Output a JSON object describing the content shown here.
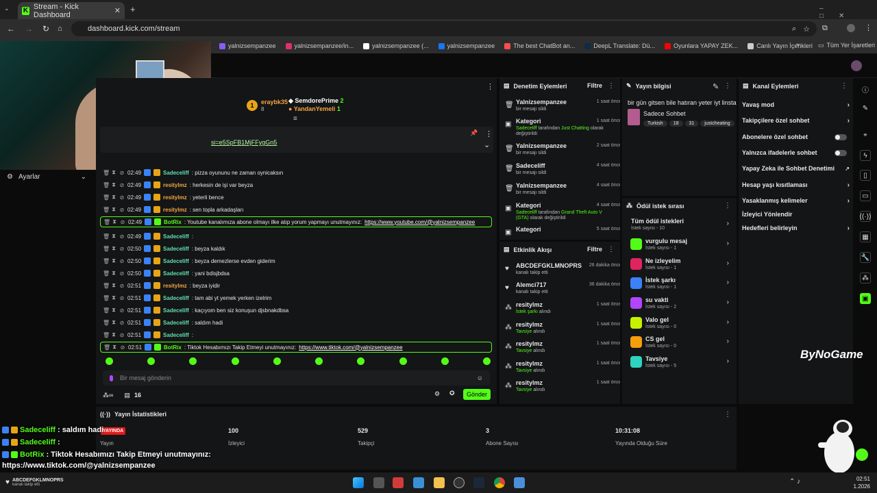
{
  "browser": {
    "tab_title": "Stream - Kick Dashboard",
    "url": "dashboard.kick.com/stream",
    "bookmarks": [
      {
        "label": "yalnizsempanzee",
        "color": "#8a5cf6"
      },
      {
        "label": "yalnizsempanzee/in...",
        "color": "#e1306c"
      },
      {
        "label": "yalnizsempanzee (...",
        "color": "#ffffff"
      },
      {
        "label": "yalnizsempanzee",
        "color": "#1877f2"
      },
      {
        "label": "The best ChatBot an...",
        "color": "#ff4d4d"
      },
      {
        "label": "DeepL Translate: Dü...",
        "color": "#0f2b46"
      },
      {
        "label": "Oyunlara YAPAY ZEK...",
        "color": "#ff0000"
      },
      {
        "label": "Canlı Yayın İçerikleri",
        "color": "#cccccc"
      }
    ],
    "all_bookmarks": "Tüm Yer İşaretleri"
  },
  "sidebar": {
    "settings_label": "Ayarlar"
  },
  "chat": {
    "top_users": [
      {
        "name": "eraybk35",
        "count": "2",
        "sub": "8"
      },
      {
        "name": "SemdorePrime",
        "count": "2"
      },
      {
        "name": "YandanYemeli",
        "count": "1"
      }
    ],
    "pinned_link": "si=e5SpFB1MjFFygGn5",
    "messages": [
      {
        "time": "02:49",
        "user": "Sadeceliff",
        "cls": "u-teal",
        "text": ": pizza oyununu ne zaman oynicaksın"
      },
      {
        "time": "02:49",
        "user": "resitylmz",
        "cls": "u-orange",
        "text": ": herkesin de işi var beyza"
      },
      {
        "time": "02:49",
        "user": "resitylmz",
        "cls": "u-orange",
        "text": ": yeterli bence"
      },
      {
        "time": "02:49",
        "user": "resitylmz",
        "cls": "u-orange",
        "text": ": sen topla arkadaşları"
      },
      {
        "time": "02:49",
        "user": "BotRix",
        "cls": "u-bot",
        "text": ": Youtube kanalımıza abone olmayı ilke atıp yorum yapmayı unutmayınız: ",
        "link": "https://www.youtube.com/@yalnizsempanzee",
        "hl": true
      },
      {
        "time": "02:49",
        "user": "Sadeceliff",
        "cls": "u-teal",
        "text": ":"
      },
      {
        "time": "02:50",
        "user": "Sadeceliff",
        "cls": "u-teal",
        "text": ": beyza kaldık"
      },
      {
        "time": "02:50",
        "user": "Sadeceliff",
        "cls": "u-teal",
        "text": ": beyza demezlerse evden giderim"
      },
      {
        "time": "02:50",
        "user": "Sadeceliff",
        "cls": "u-teal",
        "text": ": yani bdisjbdsa"
      },
      {
        "time": "02:51",
        "user": "resitylmz",
        "cls": "u-orange",
        "text": ": beyza iyidir"
      },
      {
        "time": "02:51",
        "user": "Sadeceliff",
        "cls": "u-teal",
        "text": ": tam abi yt yemek yerken izelrim"
      },
      {
        "time": "02:51",
        "user": "Sadeceliff",
        "cls": "u-teal",
        "text": ": kaçıyom ben siz konuşun djsbnakdbsa"
      },
      {
        "time": "02:51",
        "user": "Sadeceliff",
        "cls": "u-teal",
        "text": ": saldım hadi"
      },
      {
        "time": "02:51",
        "user": "Sadeceliff",
        "cls": "u-teal",
        "text": ":"
      },
      {
        "time": "02:51",
        "user": "BotRix",
        "cls": "u-bot",
        "text": ": Tiktok Hesabımızı Takip Etmeyi unutmayınız: ",
        "link": "https://www.tiktok.com/@yalnizsempanzee",
        "hl": true
      }
    ],
    "input_placeholder": "Bir mesaj gönderin",
    "viewer_count": "16",
    "send_label": "Gönder"
  },
  "moderation": {
    "title": "Denetim Eylemleri",
    "filter": "Filtre",
    "items": [
      {
        "user": "Yalnizsempanzee",
        "sub": "bir mesajı sildi",
        "time": "1 saat önce",
        "icon": "trash"
      },
      {
        "user": "Kategori",
        "sub_pre": "Sadeceliff",
        "sub_mid": " tarafından ",
        "sub_cat": "Just Chatting",
        "sub_post": " olarak değiştirildi",
        "time": "1 saat önce",
        "icon": "category"
      },
      {
        "user": "Yalnizsempanzee",
        "sub": "bir mesajı sildi",
        "time": "2 saat önce",
        "icon": "trash"
      },
      {
        "user": "Sadeceliff",
        "sub": "bir mesajı sildi",
        "time": "4 saat önce",
        "icon": "trash"
      },
      {
        "user": "Yalnizsempanzee",
        "sub": "bir mesajı sildi",
        "time": "4 saat önce",
        "icon": "trash"
      },
      {
        "user": "Kategori",
        "sub_pre": "Sadeceliff",
        "sub_mid": " tarafından ",
        "sub_cat": "Grand Theft Auto V (GTA)",
        "sub_post": " olarak değiştirildi",
        "time": "4 saat önce",
        "icon": "category"
      },
      {
        "user": "Kategori",
        "sub": "",
        "time": "5 saat önce",
        "icon": "category"
      }
    ]
  },
  "activity": {
    "title": "Etkinlik Akışı",
    "filter": "Filtre",
    "items": [
      {
        "user": "ABCDEFGKLMNOPRS",
        "sub": "kanalı takip etti",
        "time": "26 dakika önce",
        "icon": "heart"
      },
      {
        "user": "Alemci717",
        "sub": "kanalı takip etti",
        "time": "36 dakika önce",
        "icon": "heart"
      },
      {
        "user": "resitylmz",
        "reward": "İstek şarkı",
        "sub": " alındı",
        "time": "1 saat önce",
        "icon": "reward"
      },
      {
        "user": "resitylmz",
        "reward": "Tavsiye",
        "sub": " alındı",
        "time": "1 saat önce",
        "icon": "reward"
      },
      {
        "user": "resitylmz",
        "reward": "Tavsiye",
        "sub": " alındı",
        "time": "1 saat önce",
        "icon": "reward"
      },
      {
        "user": "resitylmz",
        "reward": "Tavsiye",
        "sub": " alındı",
        "time": "1 saat önce",
        "icon": "reward"
      },
      {
        "user": "resitylmz",
        "reward": "Tavsiye",
        "sub": " alındı",
        "time": "1 saat önce",
        "icon": "reward"
      }
    ]
  },
  "stream_info": {
    "title": "Yayın bilgisi",
    "stream_title": "bir gün gitsen bile hatıran yeter iyt linsta",
    "category": "Sadece Sohbet",
    "tags": [
      "Turkish",
      "18",
      "31",
      "justcheating"
    ]
  },
  "rewards": {
    "title": "Ödül istek sırası",
    "all_label": "Tüm ödül istekleri",
    "all_count": "İstek sayısı - 10",
    "items": [
      {
        "name": "vurgulu mesaj",
        "count": "İstek sayısı - 1",
        "color": "#53fc18"
      },
      {
        "name": "Ne izleyelim",
        "count": "İstek sayısı - 1",
        "color": "#e0245e"
      },
      {
        "name": "İstek şarkı",
        "count": "İstek sayısı - 1",
        "color": "#3b82f6"
      },
      {
        "name": "su vakti",
        "count": "İstek sayısı - 2",
        "color": "#b146ff"
      },
      {
        "name": "Valo gel",
        "count": "İstek sayısı - 0",
        "color": "#c7f000"
      },
      {
        "name": "CS gel",
        "count": "İstek sayısı - 0",
        "color": "#f59e0b"
      },
      {
        "name": "Tavsiye",
        "count": "İstek sayısı - 5",
        "color": "#2dd4bf"
      }
    ]
  },
  "channel_actions": {
    "title": "Kanal Eylemleri",
    "items": [
      {
        "label": "Yavaş mod",
        "kind": "chevron"
      },
      {
        "label": "Takipçilere özel sohbet",
        "kind": "chevron"
      },
      {
        "label": "Abonelere özel sohbet",
        "kind": "toggle"
      },
      {
        "label": "Yalnızca ifadelerle sohbet",
        "kind": "toggle"
      },
      {
        "label": "Yapay Zeka ile Sohbet Denetimi",
        "kind": "external"
      },
      {
        "label": "Hesap yaşı kısıtlaması",
        "kind": "chevron"
      },
      {
        "label": "Yasaklanmış kelimeler",
        "kind": "chevron"
      },
      {
        "label": "İzleyici Yönlendir",
        "kind": "none"
      },
      {
        "label": "Hedefleri belirleyin",
        "kind": "chevron"
      }
    ]
  },
  "stats": {
    "title": "Yayın İstatistikleri",
    "items": [
      {
        "value": "YAYINDA",
        "label": "Yayın"
      },
      {
        "value": "100",
        "label": "İzleyici"
      },
      {
        "value": "529",
        "label": "Takipçi"
      },
      {
        "value": "3",
        "label": "Abone Sayısı"
      },
      {
        "value": "10:31:08",
        "label": "Yayında Olduğu Süre"
      }
    ]
  },
  "overlay": {
    "lines": [
      {
        "user": "Sadeceliff",
        "text": ": saldım hadi"
      },
      {
        "user": "Sadeceliff",
        "text": ":"
      },
      {
        "user": "BotRix",
        "text": ": Tiktok Hesabımızı Takip Etmeyi unutmayınız:"
      }
    ],
    "link_line": "https://www.tiktok.com/@yalnizsempanzee",
    "brand": "ByNoGame",
    "follow_user": "ABCDEFGKLMNOPRS",
    "follow_text": "kanalı takip etti"
  },
  "taskbar": {
    "time": "02:51",
    "date": "1.2026"
  }
}
